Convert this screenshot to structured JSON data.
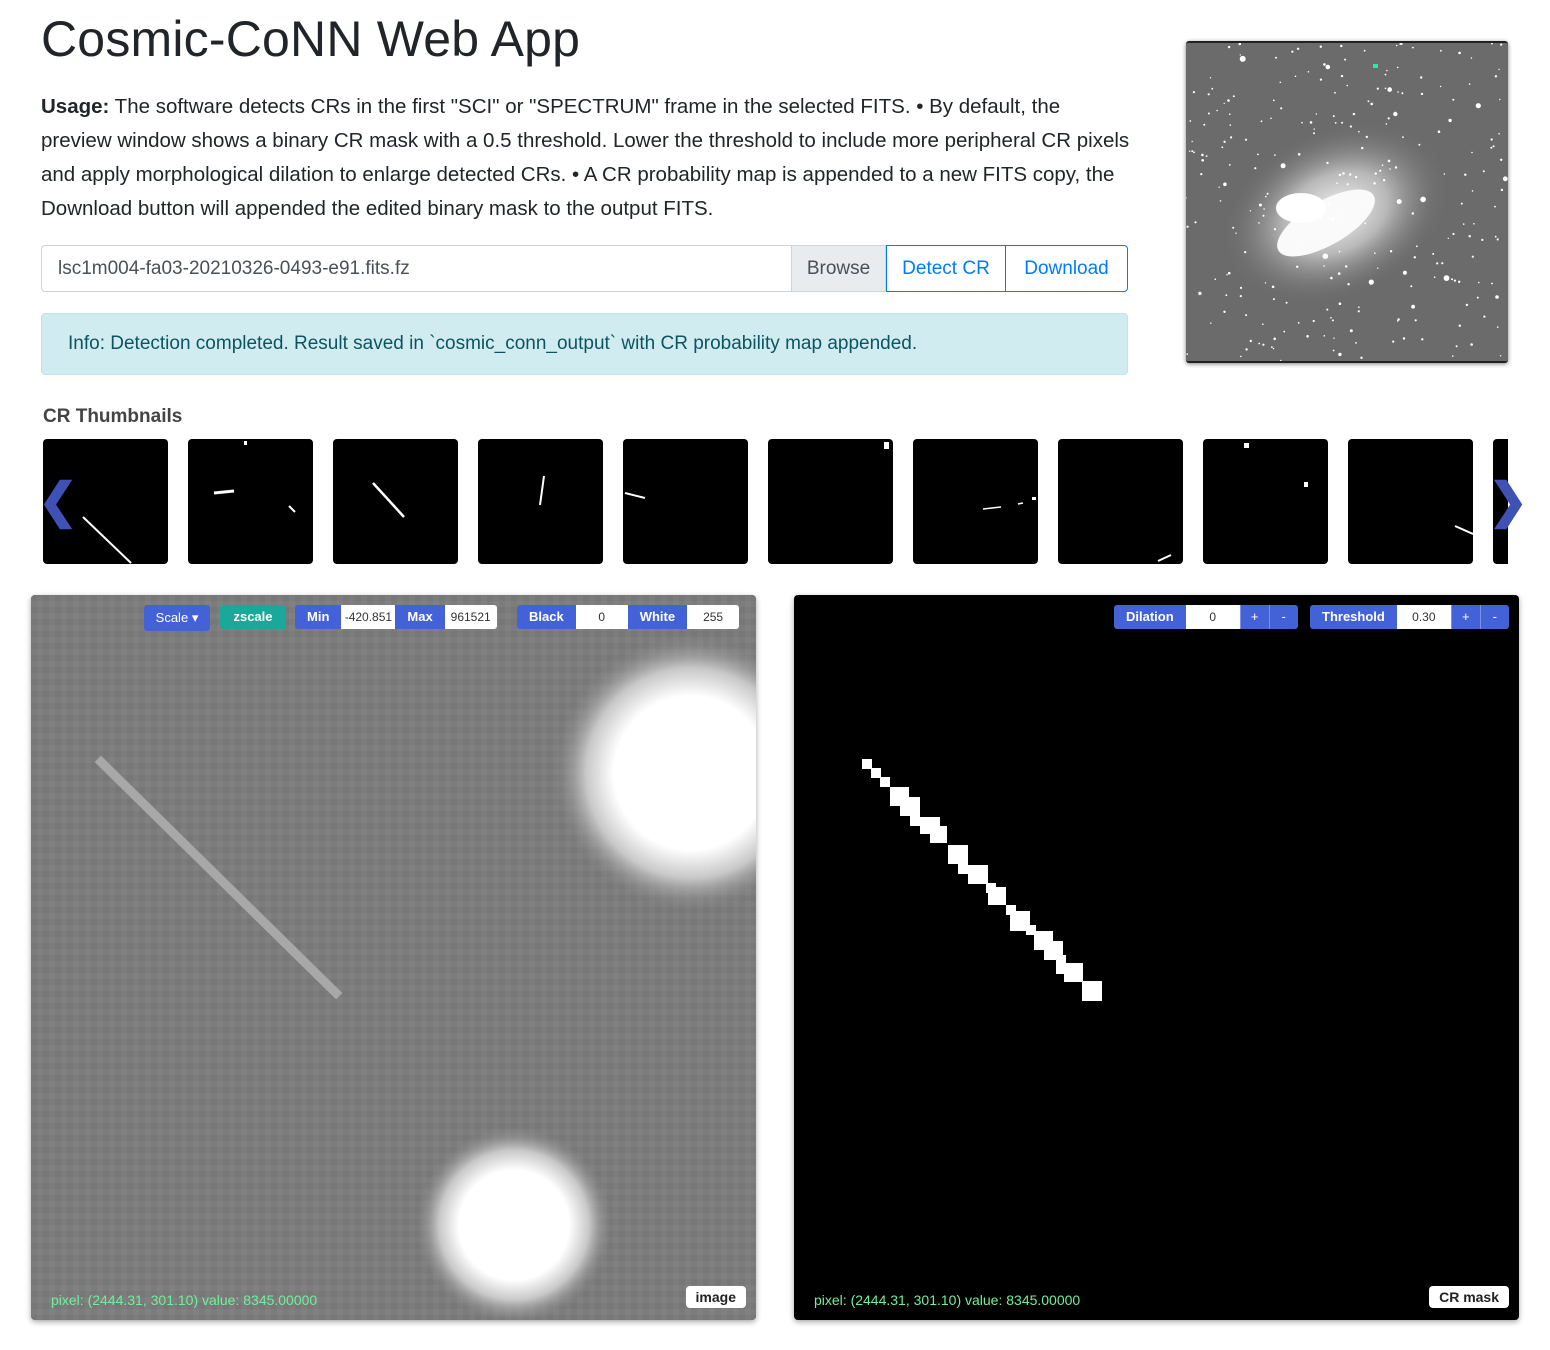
{
  "header": {
    "title": "Cosmic-CoNN Web App",
    "usage_label": "Usage:",
    "usage_text": " The software detects CRs in the first \"SCI\" or \"SPECTRUM\" frame in the selected FITS. • By default, the preview window shows a binary CR mask with a 0.5 threshold. Lower the threshold to include more peripheral CR pixels and apply morphological dilation to enlarge detected CRs. • A CR probability map is appended to a new FITS copy, the Download button will appended the edited binary mask to the output FITS."
  },
  "file": {
    "name": "lsc1m004-fa03-20210326-0493-e91.fits.fz",
    "browse_label": "Browse",
    "detect_label": "Detect CR",
    "download_label": "Download"
  },
  "info": {
    "message": "Info: Detection completed. Result saved in `cosmic_conn_output` with CR probability map appended."
  },
  "thumbnails": {
    "label": "CR Thumbnails",
    "prev_icon": "chevron-left-icon",
    "next_icon": "chevron-right-icon",
    "prev_glyph": "❮",
    "next_glyph": "❯"
  },
  "image_panel": {
    "scale_label": "Scale",
    "zscale_label": "zscale",
    "min_label": "Min",
    "min_value": "-420.851",
    "max_label": "Max",
    "max_value": "961521",
    "black_label": "Black",
    "black_value": "0",
    "white_label": "White",
    "white_value": "255",
    "pixel_info": "pixel: (2444.31, 301.10) value: 8345.00000",
    "tag": "image"
  },
  "mask_panel": {
    "dilation_label": "Dilation",
    "dilation_value": "0",
    "threshold_label": "Threshold",
    "threshold_value": "0.30",
    "plus": "+",
    "minus": "-",
    "pixel_info": "pixel: (2444.31, 301.10) value: 8345.00000",
    "tag": "CR mask"
  },
  "colors": {
    "accent": "#4462d8",
    "zscale": "#1aa89a",
    "info_bg": "#d1ecf1",
    "info_text": "#0c5460",
    "pixel_text": "#6ef09a"
  }
}
